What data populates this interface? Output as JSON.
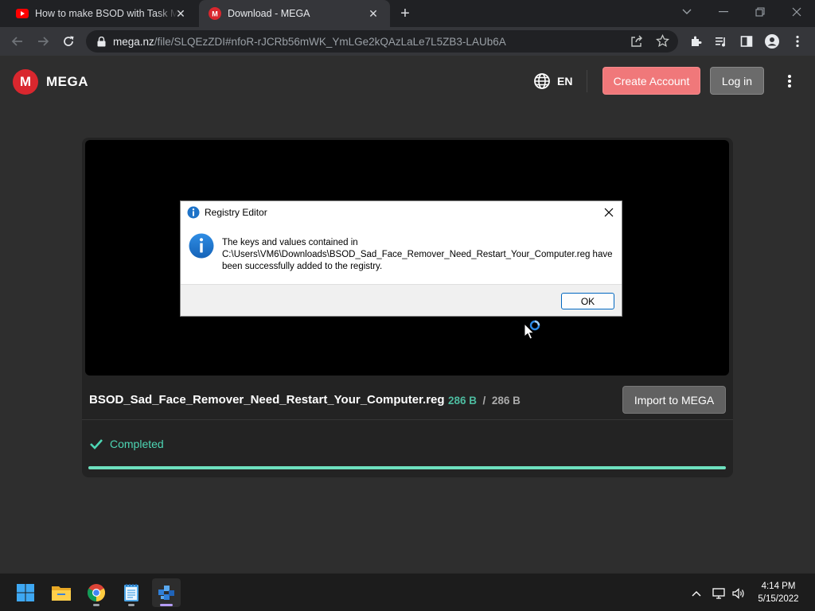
{
  "browser": {
    "tabs": [
      {
        "title": "How to make BSOD with Task Manager",
        "active": false
      },
      {
        "title": "Download - MEGA",
        "active": true
      }
    ],
    "url": {
      "host": "mega.nz",
      "path": "/file/SLQEzZDI#nfoR-rJCRb56mWK_YmLGe2kQAzLaLe7L5ZB3-LAUb6A"
    }
  },
  "mega": {
    "logo_text": "MEGA",
    "logo_letter": "M",
    "language": "EN",
    "create_account": "Create Account",
    "login": "Log in",
    "file": {
      "name": "BSOD_Sad_Face_Remover_Need_Restart_Your_Computer.reg",
      "downloaded": "286 B",
      "separator": "/",
      "total": "286 B",
      "import_label": "Import to MEGA",
      "status": "Completed",
      "progress_percent": 100
    },
    "colors": {
      "brand_red": "#d9272e",
      "create_btn": "#f0787a",
      "status_green": "#4dd6b4"
    }
  },
  "dialog": {
    "title": "Registry Editor",
    "message": "The keys and values contained in C:\\Users\\VM6\\Downloads\\BSOD_Sad_Face_Remover_Need_Restart_Your_Computer.reg have been successfully added to the registry.",
    "ok_label": "OK",
    "icon": "info-icon"
  },
  "taskbar": {
    "apps": [
      "start-icon",
      "file-explorer-icon",
      "chrome-icon",
      "notepad-icon",
      "registry-editor-icon"
    ],
    "time": "4:14 PM",
    "date": "5/15/2022"
  }
}
